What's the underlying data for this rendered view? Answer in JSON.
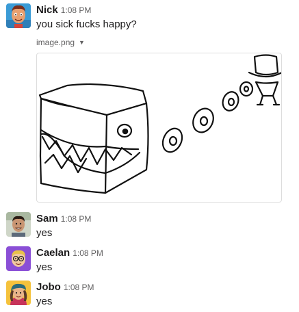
{
  "messages": [
    {
      "name": "Nick",
      "time": "1:08 PM",
      "text": "you sick fucks happy?",
      "attachment": {
        "filename": "image.png"
      }
    },
    {
      "name": "Sam",
      "time": "1:08 PM",
      "text": "yes"
    },
    {
      "name": "Caelan",
      "time": "1:08 PM",
      "text": "yes"
    },
    {
      "name": "Jobo",
      "time": "1:08 PM",
      "text": "yes"
    }
  ],
  "colors": {
    "text_primary": "#1d1c1d",
    "text_secondary": "#616061",
    "nick_avatar_bg": "#f2a33a",
    "sam_avatar_bg": "#cfd6c8",
    "caelan_avatar_bg": "#8a4fd6",
    "jobo_avatar_bg": "#f5c23c"
  },
  "icons": [
    "chevron-down-icon"
  ]
}
